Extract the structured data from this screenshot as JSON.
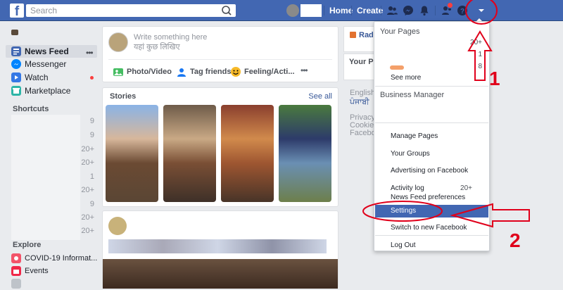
{
  "topbar": {
    "logo": "f",
    "search_placeholder": "Search",
    "home": "Home",
    "create": "Create"
  },
  "left": {
    "items": [
      {
        "label": "News Feed",
        "color": "#4267b2"
      },
      {
        "label": "Messenger",
        "color": "#0084ff"
      },
      {
        "label": "Watch",
        "color": "#3578e5"
      },
      {
        "label": "Marketplace",
        "color": "#2eb5a7"
      }
    ],
    "shortcuts_title": "Shortcuts",
    "shortcut_counts": [
      "9",
      "9",
      "20+",
      "20+",
      "1",
      "20+",
      "9",
      "20+",
      "20+"
    ],
    "explore_title": "Explore",
    "explore_items": [
      "COVID-19 Informat...",
      "Events"
    ]
  },
  "composer": {
    "placeholder_en": "Write something here",
    "placeholder_hi": "यहां कुछ लिखिए",
    "photo_video": "Photo/Video",
    "tag_friends": "Tag friends",
    "feeling": "Feeling/Acti..."
  },
  "stories": {
    "title": "Stories",
    "see_all": "See all"
  },
  "right": {
    "name_snip": "Radh",
    "your_pages_snip": "Your Pag",
    "lang1": "English (I",
    "lang2": "ਪੰਜਾਬੀ",
    "privacy": "Privacy",
    "cookies": "Cookies",
    "facebook": "Facebook"
  },
  "dropdown": {
    "your_pages": "Your Pages",
    "counts": [
      "20+",
      "1",
      "8"
    ],
    "see_more": "See more",
    "business_manager": "Business Manager",
    "items": [
      "Manage Pages",
      "Your Groups",
      "Advertising on Facebook",
      "Activity log",
      "News Feed preferences",
      "Settings",
      "Switch to new Facebook",
      "Log Out"
    ],
    "activity_count": "20+"
  },
  "annotations": {
    "num1": "1",
    "num2": "2",
    "color": "#e0001b"
  }
}
